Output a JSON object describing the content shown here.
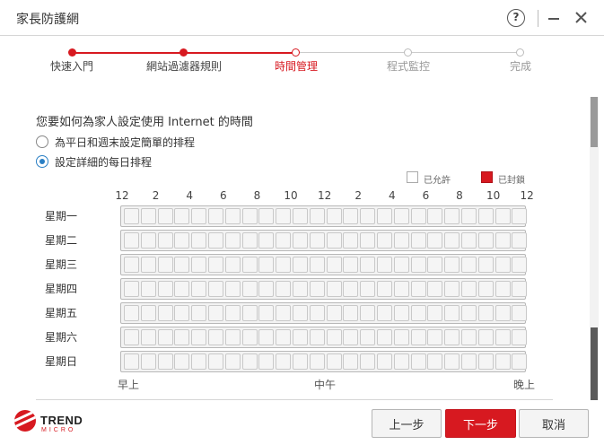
{
  "window": {
    "title": "家長防護網"
  },
  "steps": [
    {
      "label": "快速入門",
      "state": "done"
    },
    {
      "label": "網站過濾器規則",
      "state": "done"
    },
    {
      "label": "時間管理",
      "state": "current"
    },
    {
      "label": "程式監控",
      "state": "todo"
    },
    {
      "label": "完成",
      "state": "todo"
    }
  ],
  "content": {
    "question": "您要如何為家人設定使用 Internet 的時間",
    "options": [
      {
        "label": "為平日和週末設定簡單的排程",
        "checked": false
      },
      {
        "label": "設定詳細的每日排程",
        "checked": true
      }
    ],
    "legend": {
      "allowed": "已允許",
      "blocked": "已封鎖"
    },
    "hours": [
      "12",
      "2",
      "4",
      "6",
      "8",
      "10",
      "12",
      "2",
      "4",
      "6",
      "8",
      "10",
      "12"
    ],
    "days": [
      "星期一",
      "星期二",
      "星期三",
      "星期四",
      "星期五",
      "星期六",
      "星期日"
    ],
    "axis": {
      "start": "早上",
      "middle": "中午",
      "end": "晚上"
    }
  },
  "footer": {
    "brand_top": "TREND",
    "brand_bottom": "MICRO",
    "prev_label": "上一步",
    "next_label": "下一步",
    "cancel_label": "取消"
  },
  "colors": {
    "accent": "#d71920",
    "radio": "#2a7fc4"
  }
}
